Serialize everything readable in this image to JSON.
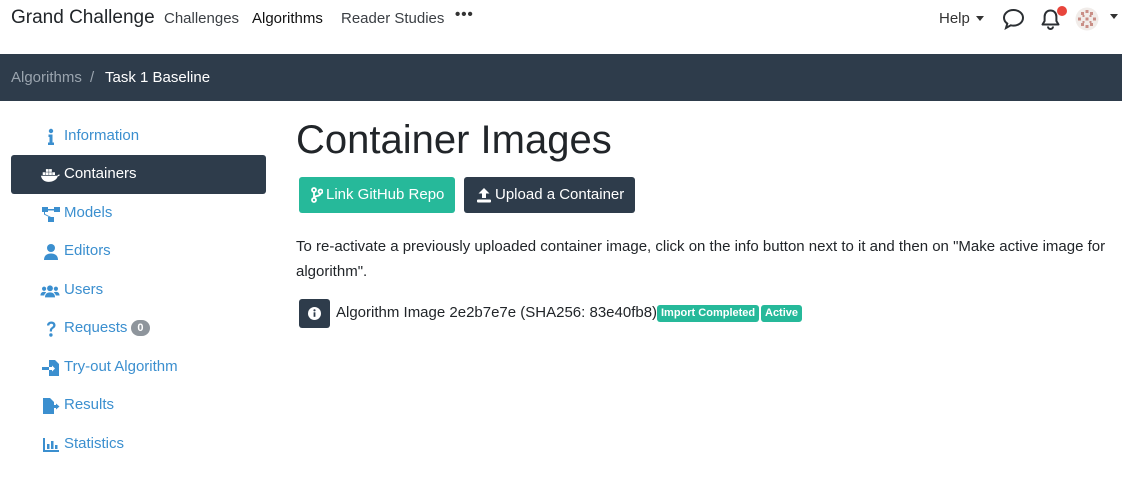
{
  "navbar": {
    "brand": "Grand Challenge",
    "links": [
      "Challenges",
      "Algorithms",
      "Reader Studies"
    ],
    "more": "•••",
    "help": "Help",
    "icons": [
      "chat-icon",
      "bell-icon",
      "avatar"
    ],
    "notification_color": "#e8453c"
  },
  "breadcrumb": {
    "items": [
      "Algorithms",
      "Task 1 Baseline"
    ],
    "separator": "/"
  },
  "sidebar": {
    "items": [
      {
        "label": "Information",
        "icon": "info-icon"
      },
      {
        "label": "Containers",
        "icon": "docker-icon",
        "active": true
      },
      {
        "label": "Models",
        "icon": "sitemap-icon"
      },
      {
        "label": "Editors",
        "icon": "user-icon"
      },
      {
        "label": "Users",
        "icon": "users-icon"
      },
      {
        "label": "Requests",
        "icon": "question-icon",
        "badge": "0"
      },
      {
        "label": "Try-out Algorithm",
        "icon": "file-import-icon"
      },
      {
        "label": "Results",
        "icon": "file-export-icon"
      },
      {
        "label": "Statistics",
        "icon": "chart-bar-icon"
      }
    ]
  },
  "main": {
    "title": "Container Images",
    "link_github_label": "Link GitHub Repo",
    "upload_label": "Upload a Container",
    "info_text": "To re-activate a previously uploaded container image, click on the info button next to it and then on \"Make active image for algorithm\".",
    "image": {
      "name": "Algorithm Image 2e2b7e7e (SHA256: 83e40fb8)",
      "status_badge": "Import Completed",
      "active_badge": "Active"
    }
  },
  "colors": {
    "dark": "#2e3c4b",
    "accent_green": "#26b99a",
    "link_blue": "#3b8fcf"
  }
}
